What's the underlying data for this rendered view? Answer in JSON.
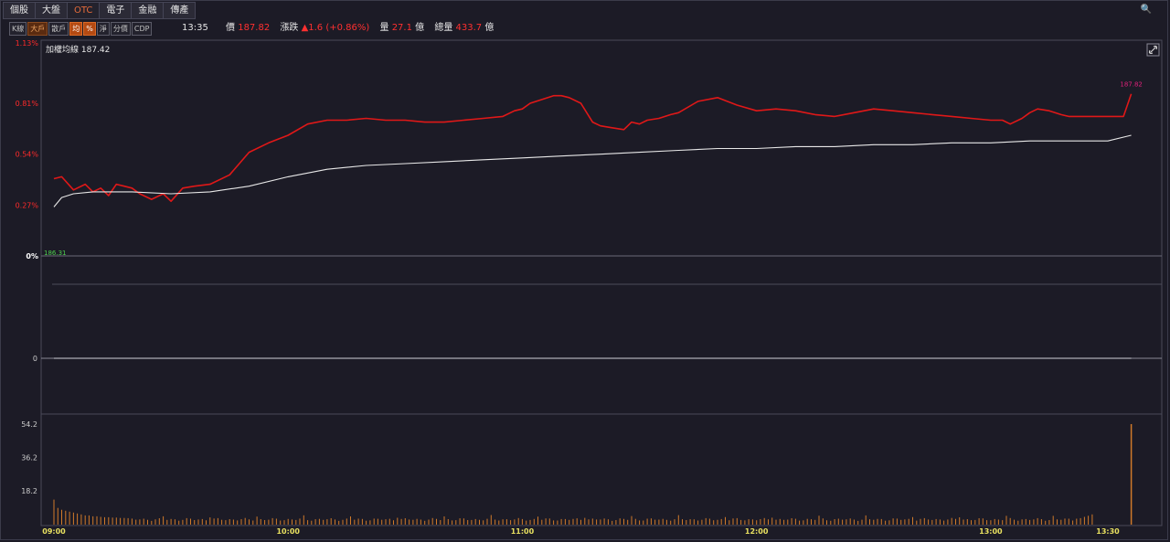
{
  "tabs": [
    {
      "label": "個股",
      "active": false
    },
    {
      "label": "大盤",
      "active": false
    },
    {
      "label": "OTC",
      "active": true
    },
    {
      "label": "電子",
      "active": false
    },
    {
      "label": "金融",
      "active": false
    },
    {
      "label": "傳產",
      "active": false
    }
  ],
  "toolbar": [
    {
      "label": "K線",
      "state": "off"
    },
    {
      "label": "大戶",
      "state": "alt"
    },
    {
      "label": "散戶",
      "state": "off"
    },
    {
      "label": "均",
      "state": "on"
    },
    {
      "label": "%",
      "state": "on"
    },
    {
      "label": "淨",
      "state": "off"
    },
    {
      "label": "分價",
      "state": "off"
    },
    {
      "label": "CDP",
      "state": "off"
    }
  ],
  "quote": {
    "time": "13:35",
    "price_label": "價",
    "price": "187.82",
    "change_label": "漲跌",
    "change": "▲1.6 (+0.86%)",
    "volume_label": "量",
    "volume": "27.1",
    "volume_unit": "億",
    "total_label": "總量",
    "total": "433.7",
    "total_unit": "億"
  },
  "colors": {
    "price_line": "#e01818",
    "avg_line": "#e8e8e8",
    "volume_bar": "#d07a2a",
    "up_label": "#ff2a2a",
    "peak_label": "#e0207a",
    "base_label": "#4ecf4e",
    "time_label": "#e8e060"
  },
  "chart_data": [
    {
      "type": "line",
      "panel": "price",
      "legend": "加權均線 187.42",
      "y_tick_labels": [
        "1.13%",
        "0.81%",
        "0.54%",
        "0.27%",
        "0%"
      ],
      "ylim": [
        0,
        1.13
      ],
      "base_price_label": "186.31",
      "peak_label": "187.82",
      "x_tick_labels": [
        "09:00",
        "10:00",
        "11:00",
        "12:00",
        "13:00",
        "13:30"
      ],
      "x_ticks_min": [
        0,
        60,
        120,
        180,
        240,
        270
      ],
      "xlim": [
        0,
        270
      ],
      "series": [
        {
          "key": "price",
          "x": [
            0,
            2,
            5,
            8,
            10,
            12,
            14,
            16,
            18,
            20,
            22,
            25,
            28,
            30,
            33,
            36,
            40,
            45,
            50,
            55,
            60,
            65,
            70,
            75,
            80,
            85,
            90,
            95,
            100,
            105,
            110,
            115,
            118,
            120,
            122,
            125,
            128,
            130,
            132,
            135,
            138,
            140,
            143,
            146,
            148,
            150,
            152,
            155,
            158,
            160,
            165,
            170,
            175,
            180,
            185,
            190,
            195,
            200,
            205,
            210,
            215,
            220,
            225,
            230,
            235,
            240,
            243,
            245,
            248,
            250,
            252,
            255,
            258,
            260,
            265,
            270,
            272,
            274,
            276
          ],
          "y": [
            0.41,
            0.42,
            0.35,
            0.38,
            0.34,
            0.36,
            0.32,
            0.38,
            0.37,
            0.36,
            0.33,
            0.3,
            0.33,
            0.29,
            0.36,
            0.37,
            0.38,
            0.43,
            0.55,
            0.6,
            0.64,
            0.7,
            0.72,
            0.72,
            0.73,
            0.72,
            0.72,
            0.71,
            0.71,
            0.72,
            0.73,
            0.74,
            0.77,
            0.78,
            0.81,
            0.83,
            0.85,
            0.85,
            0.84,
            0.81,
            0.71,
            0.69,
            0.68,
            0.67,
            0.71,
            0.7,
            0.72,
            0.73,
            0.75,
            0.76,
            0.82,
            0.84,
            0.8,
            0.77,
            0.78,
            0.77,
            0.75,
            0.74,
            0.76,
            0.78,
            0.77,
            0.76,
            0.75,
            0.74,
            0.73,
            0.72,
            0.72,
            0.7,
            0.73,
            0.76,
            0.78,
            0.77,
            0.75,
            0.74,
            0.74,
            0.74,
            0.74,
            0.74,
            0.86
          ]
        },
        {
          "key": "avg",
          "x": [
            0,
            2,
            5,
            10,
            20,
            30,
            40,
            50,
            60,
            70,
            80,
            90,
            100,
            110,
            120,
            130,
            140,
            150,
            160,
            170,
            180,
            190,
            200,
            210,
            220,
            230,
            240,
            250,
            260,
            270,
            276
          ],
          "y": [
            0.26,
            0.31,
            0.33,
            0.34,
            0.34,
            0.33,
            0.34,
            0.37,
            0.42,
            0.46,
            0.48,
            0.49,
            0.5,
            0.51,
            0.52,
            0.53,
            0.54,
            0.55,
            0.56,
            0.57,
            0.57,
            0.58,
            0.58,
            0.59,
            0.59,
            0.6,
            0.6,
            0.61,
            0.61,
            0.61,
            0.64
          ]
        }
      ]
    },
    {
      "type": "line",
      "panel": "net",
      "y_tick_labels": [
        "0"
      ],
      "series": [
        {
          "key": "net",
          "x": [
            0,
            276
          ],
          "y": [
            0,
            0
          ]
        }
      ]
    },
    {
      "type": "bar",
      "panel": "volume",
      "y_tick_labels": [
        "54.2",
        "36.2",
        "18.2"
      ],
      "ylim": [
        0,
        54.2
      ],
      "spike": {
        "x": 276,
        "value": 54.2
      },
      "minute_values_head": [
        13.5,
        9,
        8,
        7.5,
        7,
        6.5,
        6,
        5.5,
        5,
        5,
        4.5,
        4.5,
        4.2,
        4,
        4,
        3.8,
        3.8,
        3.6,
        3.6,
        3.5
      ],
      "baseline_value": 2.8,
      "tail_pulse_values": [
        3.2,
        3.5,
        4.2,
        4.8,
        5.5
      ]
    }
  ]
}
